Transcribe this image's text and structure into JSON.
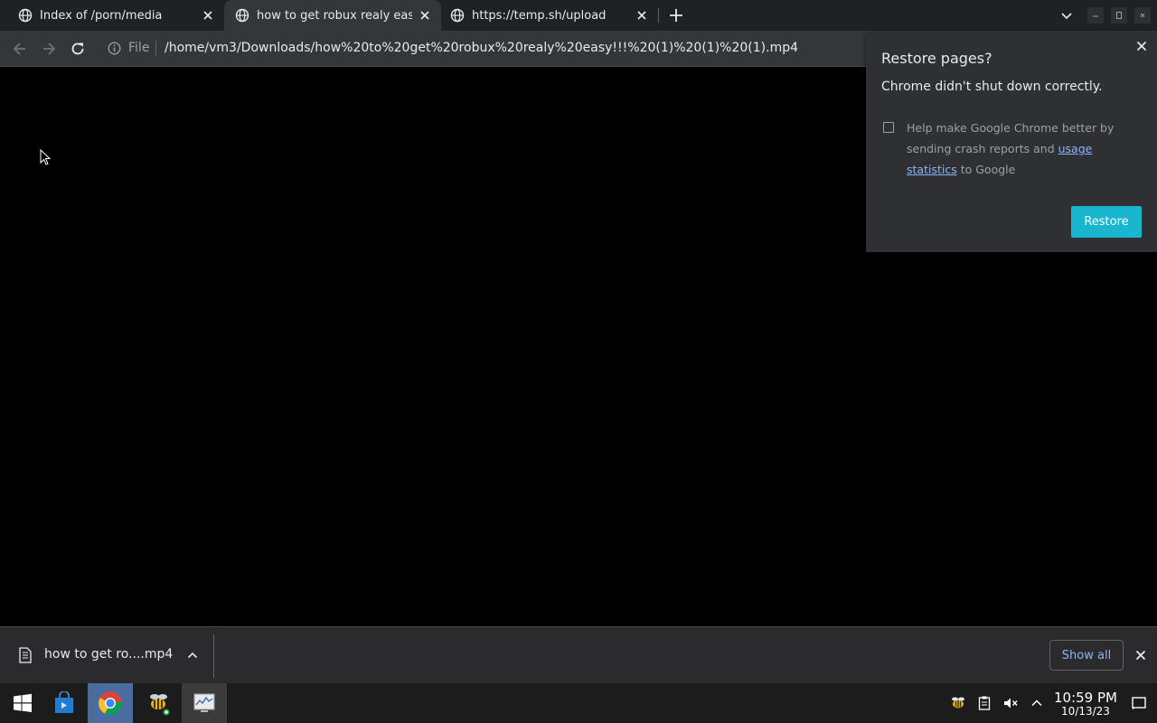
{
  "tabs": [
    {
      "title": "Index of /porn/media",
      "active": false
    },
    {
      "title": "how to get robux realy easy!!!",
      "active": true
    },
    {
      "title": "https://temp.sh/upload",
      "active": false
    }
  ],
  "toolbar": {
    "scheme_label": "File",
    "url": "/home/vm3/Downloads/how%20to%20get%20robux%20realy%20easy!!!%20(1)%20(1)%20(1).mp4"
  },
  "restore_bubble": {
    "title": "Restore pages?",
    "message": "Chrome didn't shut down correctly.",
    "consent_text_before": "Help make Google Chrome better by sending crash reports and ",
    "consent_link": "usage statistics",
    "consent_text_after": " to Google",
    "consent_checked": false,
    "restore_label": "Restore"
  },
  "download_shelf": {
    "file_name": "how to get ro....mp4",
    "show_all_label": "Show all"
  },
  "taskbar": {
    "apps": [
      "start-icon",
      "store-icon",
      "chrome-icon",
      "bee-app-icon",
      "system-monitor-icon"
    ],
    "tray": [
      "bee-tray-icon",
      "clipboard-icon",
      "volume-muted-icon",
      "tray-chevron-up-icon"
    ],
    "time": "10:59 PM",
    "date": "10/13/23"
  },
  "colors": {
    "accent": "#1ab5ce",
    "link": "#8ab4f8",
    "tab_strip": "#202124",
    "toolbar": "#35363a"
  }
}
